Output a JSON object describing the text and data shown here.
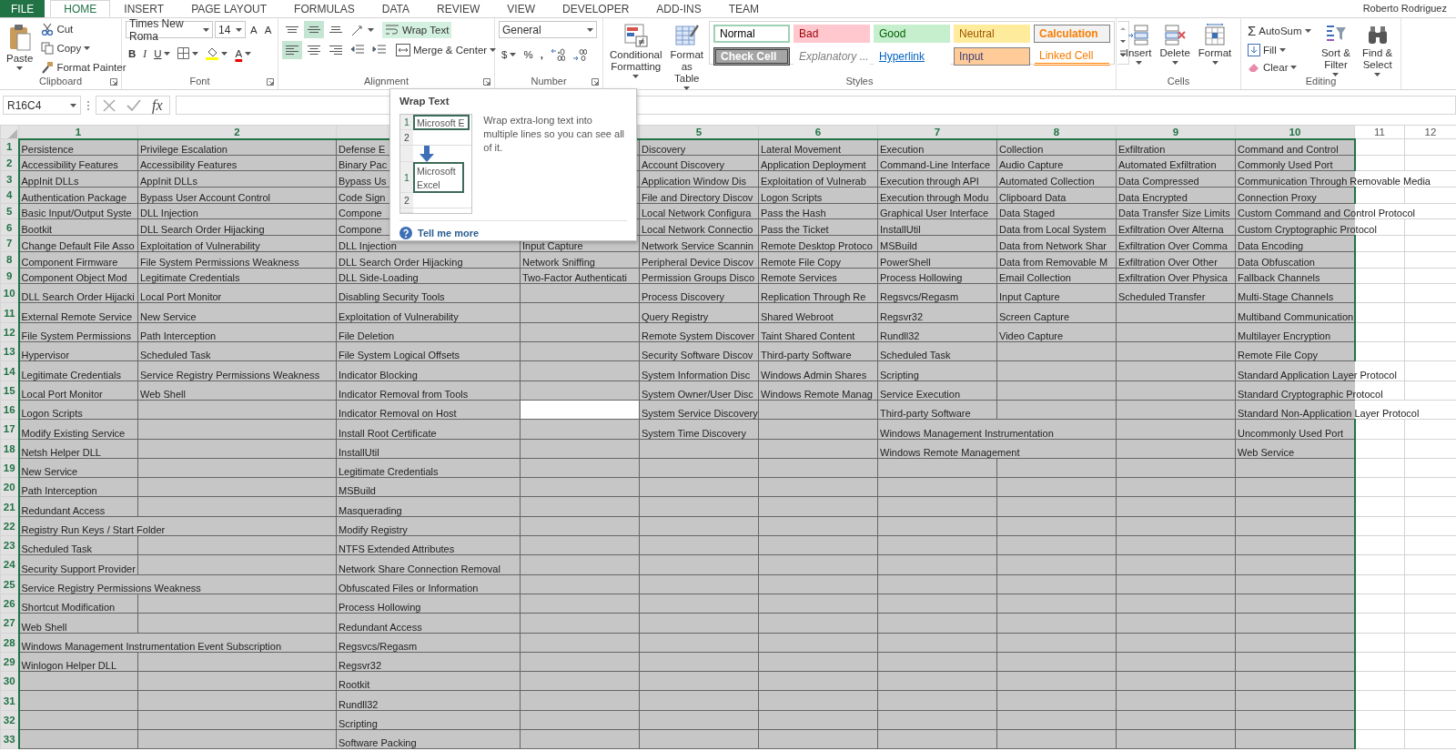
{
  "tabs": [
    {
      "label": "FILE",
      "kind": "file",
      "selected": false
    },
    {
      "label": "HOME",
      "kind": "tab",
      "selected": true
    },
    {
      "label": "INSERT",
      "kind": "tab",
      "selected": false
    },
    {
      "label": "PAGE LAYOUT",
      "kind": "tab",
      "selected": false
    },
    {
      "label": "FORMULAS",
      "kind": "tab",
      "selected": false
    },
    {
      "label": "DATA",
      "kind": "tab",
      "selected": false
    },
    {
      "label": "REVIEW",
      "kind": "tab",
      "selected": false
    },
    {
      "label": "VIEW",
      "kind": "tab",
      "selected": false
    },
    {
      "label": "DEVELOPER",
      "kind": "tab",
      "selected": false
    },
    {
      "label": "ADD-INS",
      "kind": "tab",
      "selected": false
    },
    {
      "label": "TEAM",
      "kind": "tab",
      "selected": false
    }
  ],
  "user": "Roberto Rodriguez",
  "ribbon": {
    "clipboard": {
      "label": "Clipboard",
      "paste": "Paste",
      "cut": "Cut",
      "copy": "Copy",
      "format_painter": "Format Painter"
    },
    "font": {
      "label": "Font",
      "name": "Times New Roma",
      "size": "14",
      "grow": "A",
      "shrink": "A",
      "bold": "B",
      "italic": "I",
      "underline": "U",
      "fore_letter": "A"
    },
    "alignment": {
      "label": "Alignment",
      "vertical": [
        {
          "selected": false
        },
        {
          "selected": true
        },
        {
          "selected": false
        }
      ],
      "horizontal": [
        {
          "selected": true
        },
        {
          "selected": false
        },
        {
          "selected": false
        }
      ],
      "wrap_text": {
        "label": "Wrap Text",
        "hovered": true
      },
      "merge": "Merge & Center"
    },
    "number": {
      "label": "Number",
      "format": "General",
      "currency": "$",
      "percent": "%",
      "comma": ","
    },
    "styles": {
      "label": "Styles",
      "conditional": "Conditional Formatting",
      "format_table": "Format as Table",
      "gallery": [
        {
          "label": "Normal",
          "kind": "normal",
          "color": "#ffffff",
          "selected": true
        },
        {
          "label": "Bad",
          "kind": "bad",
          "color": "#ffc7ce",
          "selected": false
        },
        {
          "label": "Good",
          "kind": "good",
          "color": "#c6efce",
          "selected": false
        },
        {
          "label": "Neutral",
          "kind": "neutral",
          "color": "#ffeb9c",
          "selected": false
        },
        {
          "label": "Calculation",
          "kind": "calculation",
          "color": "#f2f2f2",
          "selected": false
        },
        {
          "label": "Check Cell",
          "kind": "check",
          "color": "#a5a5a5",
          "selected": false
        },
        {
          "label": "Explanatory ...",
          "kind": "explanatory",
          "color": "#ffffff",
          "selected": false
        },
        {
          "label": "Hyperlink",
          "kind": "hyperlink",
          "color": "#ffffff",
          "selected": false
        },
        {
          "label": "Input",
          "kind": "input",
          "color": "#ffcc99",
          "selected": false
        },
        {
          "label": "Linked Cell",
          "kind": "linked",
          "color": "#ffffff",
          "selected": false
        }
      ]
    },
    "cells": {
      "label": "Cells",
      "insert": "Insert",
      "delete": "Delete",
      "format": "Format"
    },
    "editing": {
      "label": "Editing",
      "autosum_symbol": "Σ",
      "autosum": "AutoSum",
      "fill": "Fill",
      "clear": "Clear",
      "sort": "Sort & Filter",
      "find": "Find & Select"
    }
  },
  "formula_bar": {
    "name_box": "R16C4",
    "function": "fx"
  },
  "tooltip": {
    "title": "Wrap Text",
    "before": {
      "rows": [
        "1",
        "2"
      ],
      "text": "Microsoft E"
    },
    "after": {
      "rows": [
        "1",
        "2"
      ],
      "text": "Microsoft Excel"
    },
    "description": "Wrap extra-long text into multiple lines so you can see all of it.",
    "link": "Tell me more"
  },
  "sheet": {
    "columns": [
      {
        "label": "1",
        "selected": true
      },
      {
        "label": "2",
        "selected": true
      },
      {
        "selected": true
      },
      {
        "selected": true
      },
      {
        "label": "5",
        "selected": true
      },
      {
        "label": "6",
        "selected": true
      },
      {
        "label": "7",
        "selected": true
      },
      {
        "label": "8",
        "selected": true
      },
      {
        "label": "9",
        "selected": true
      },
      {
        "label": "10",
        "selected": true
      },
      {
        "label": "11",
        "selected": false
      },
      {
        "label": "12",
        "selected": false
      }
    ],
    "rows": [
      {
        "label": "1",
        "selected": true,
        "cells": [
          "Persistence",
          "Privilege Escalation",
          "Defense E",
          null,
          "Discovery",
          "Lateral Movement",
          "Execution",
          "Collection",
          "Exfiltration",
          "Command and Control"
        ]
      },
      {
        "label": "2",
        "selected": true,
        "cells": [
          "Accessibility Features",
          "Accessibility Features",
          "Binary Pac",
          null,
          "Account Discovery",
          "Application Deployment",
          "Command-Line Interface",
          "Audio Capture",
          "Automated Exfiltration",
          "Commonly Used Port"
        ]
      },
      {
        "label": "3",
        "selected": true,
        "cells": [
          "AppInit DLLs",
          "AppInit DLLs",
          "Bypass Us",
          null,
          "Application Window Dis",
          "Exploitation of Vulnerab",
          "Execution through API",
          "Automated Collection",
          "Data Compressed",
          "Communication Through Removable Media"
        ]
      },
      {
        "label": "4",
        "selected": true,
        "cells": [
          "Authentication Package",
          "Bypass User Account Control",
          "Code Sign",
          null,
          "File and Directory Discov",
          "Logon Scripts",
          "Execution through Modu",
          "Clipboard Data",
          "Data Encrypted",
          "Connection Proxy"
        ]
      },
      {
        "label": "5",
        "selected": true,
        "cells": [
          "Basic Input/Output Syste",
          "DLL Injection",
          "Compone",
          null,
          "Local Network Configura",
          "Pass the Hash",
          "Graphical User Interface",
          "Data Staged",
          "Data Transfer Size Limits",
          "Custom Command and Control Protocol"
        ]
      },
      {
        "label": "6",
        "selected": true,
        "cells": [
          "Bootkit",
          "DLL Search Order Hijacking",
          "Compone",
          null,
          "Local Network Connectio",
          "Pass the Ticket",
          "InstallUtil",
          "Data from Local System",
          "Exfiltration Over Alterna",
          "Custom Cryptographic Protocol"
        ]
      },
      {
        "label": "7",
        "selected": true,
        "cells": [
          "Change Default File Asso",
          "Exploitation of Vulnerability",
          "DLL Injection",
          "Input Capture",
          "Network Service Scannin",
          "Remote Desktop Protoco",
          "MSBuild",
          "Data from Network Shar",
          "Exfiltration Over Comma",
          "Data Encoding"
        ]
      },
      {
        "label": "8",
        "selected": true,
        "cells": [
          "Component Firmware",
          "File System Permissions Weakness",
          "DLL Search Order Hijacking",
          "Network Sniffing",
          "Peripheral Device Discov",
          "Remote File Copy",
          "PowerShell",
          "Data from Removable M",
          "Exfiltration Over Other",
          "Data Obfuscation"
        ]
      },
      {
        "label": "9",
        "selected": true,
        "cells": [
          "Component Object Mod",
          "Legitimate Credentials",
          "DLL Side-Loading",
          "Two-Factor Authenticati",
          "Permission Groups Disco",
          "Remote Services",
          "Process Hollowing",
          "Email Collection",
          "Exfiltration Over Physica",
          "Fallback Channels"
        ]
      },
      {
        "label": "10",
        "selected": true,
        "cells": [
          "DLL Search Order Hijacki",
          "Local Port Monitor",
          "Disabling Security Tools",
          null,
          "Process Discovery",
          "Replication Through Re",
          "Regsvcs/Regasm",
          "Input Capture",
          "Scheduled Transfer",
          "Multi-Stage Channels"
        ]
      },
      {
        "label": "11",
        "selected": true,
        "cells": [
          "External Remote Service",
          "New Service",
          "Exploitation of Vulnerability",
          null,
          "Query Registry",
          "Shared Webroot",
          "Regsvr32",
          "Screen Capture",
          null,
          "Multiband Communication"
        ]
      },
      {
        "label": "12",
        "selected": true,
        "cells": [
          "File System Permissions",
          "Path Interception",
          "File Deletion",
          null,
          "Remote System Discover",
          "Taint Shared Content",
          "Rundll32",
          "Video Capture",
          null,
          "Multilayer Encryption"
        ]
      },
      {
        "label": "13",
        "selected": true,
        "cells": [
          "Hypervisor",
          "Scheduled Task",
          "File System Logical Offsets",
          null,
          "Security Software Discov",
          "Third-party Software",
          "Scheduled Task",
          null,
          null,
          "Remote File Copy"
        ]
      },
      {
        "label": "14",
        "selected": true,
        "cells": [
          "Legitimate Credentials",
          "Service Registry Permissions Weakness",
          "Indicator Blocking",
          null,
          "System Information Disc",
          "Windows Admin Shares",
          "Scripting",
          null,
          null,
          "Standard Application Layer Protocol"
        ]
      },
      {
        "label": "15",
        "selected": true,
        "cells": [
          "Local Port Monitor",
          "Web Shell",
          "Indicator Removal from Tools",
          null,
          "System Owner/User Disc",
          "Windows Remote Manag",
          "Service Execution",
          null,
          null,
          "Standard Cryptographic Protocol"
        ]
      },
      {
        "label": "16",
        "selected": true,
        "cells": [
          "Logon Scripts",
          null,
          "Indicator Removal on Host",
          {
            "active": true
          },
          "System Service Discovery",
          null,
          "Third-party Software",
          null,
          null,
          "Standard Non-Application Layer Protocol"
        ]
      },
      {
        "label": "17",
        "selected": true,
        "cells": [
          "Modify Existing Service",
          null,
          "Install Root Certificate",
          null,
          "System Time Discovery",
          null,
          "Windows Management Instrumentation",
          null,
          null,
          "Uncommonly Used Port"
        ]
      },
      {
        "label": "18",
        "selected": true,
        "cells": [
          "Netsh Helper DLL",
          null,
          "InstallUtil",
          null,
          null,
          null,
          "Windows Remote Management",
          null,
          null,
          "Web Service"
        ]
      },
      {
        "label": "19",
        "selected": true,
        "cells": [
          "New Service",
          null,
          "Legitimate Credentials"
        ]
      },
      {
        "label": "20",
        "selected": true,
        "cells": [
          "Path Interception",
          null,
          "MSBuild"
        ]
      },
      {
        "label": "21",
        "selected": true,
        "cells": [
          "Redundant Access",
          null,
          "Masquerading"
        ]
      },
      {
        "label": "22",
        "selected": true,
        "cells": [
          "Registry Run Keys / Start Folder",
          null,
          "Modify Registry"
        ]
      },
      {
        "label": "23",
        "selected": true,
        "cells": [
          "Scheduled Task",
          null,
          "NTFS Extended Attributes"
        ]
      },
      {
        "label": "24",
        "selected": true,
        "cells": [
          "Security Support Provider",
          null,
          "Network Share Connection Removal"
        ]
      },
      {
        "label": "25",
        "selected": true,
        "cells": [
          "Service Registry Permissions Weakness",
          null,
          "Obfuscated Files or Information"
        ]
      },
      {
        "label": "26",
        "selected": true,
        "cells": [
          "Shortcut Modification",
          null,
          "Process Hollowing"
        ]
      },
      {
        "label": "27",
        "selected": true,
        "cells": [
          "Web Shell",
          null,
          "Redundant Access"
        ]
      },
      {
        "label": "28",
        "selected": true,
        "cells": [
          "Windows Management Instrumentation Event Subscription",
          null,
          "Regsvcs/Regasm"
        ]
      },
      {
        "label": "29",
        "selected": true,
        "cells": [
          "Winlogon Helper DLL",
          null,
          "Regsvr32"
        ]
      },
      {
        "label": "30",
        "selected": true,
        "cells": [
          null,
          null,
          "Rootkit"
        ]
      },
      {
        "label": "31",
        "selected": true,
        "cells": [
          null,
          null,
          "Rundll32"
        ]
      },
      {
        "label": "32",
        "selected": true,
        "cells": [
          null,
          null,
          "Scripting"
        ]
      },
      {
        "label": "33",
        "selected": true,
        "cells": [
          null,
          null,
          "Software Packing"
        ]
      }
    ]
  }
}
